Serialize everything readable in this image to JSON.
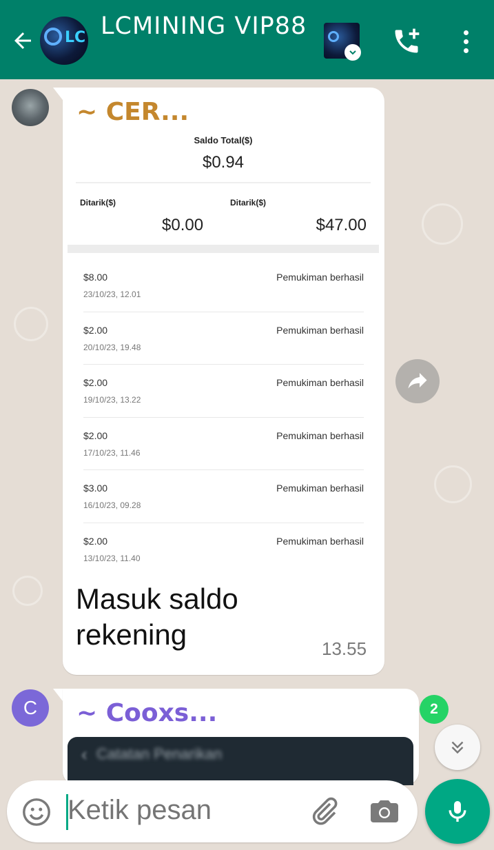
{
  "header": {
    "title": "LCMINING VIP88",
    "avatar_icon": "group-avatar",
    "back_icon": "arrow-left-icon",
    "video_icon": "video-call-icon",
    "call_icon": "add-call-icon",
    "menu_icon": "more-vertical-icon",
    "avatar_logo_text": "LC"
  },
  "messages": [
    {
      "sender": "~ CER...",
      "sender_color": "#c4872d",
      "screenshot": {
        "saldo_label": "Saldo Total($)",
        "saldo_value": "$0.94",
        "ditarik_label_1": "Ditarik($)",
        "ditarik_value_1": "$0.00",
        "ditarik_label_2": "Ditarik($)",
        "ditarik_value_2": "$47.00",
        "transactions": [
          {
            "amount": "$8.00",
            "date": "23/10/23, 12.01",
            "status": "Pemukiman berhasil"
          },
          {
            "amount": "$2.00",
            "date": "20/10/23, 19.48",
            "status": "Pemukiman berhasil"
          },
          {
            "amount": "$2.00",
            "date": "19/10/23, 13.22",
            "status": "Pemukiman berhasil"
          },
          {
            "amount": "$2.00",
            "date": "17/10/23, 11.46",
            "status": "Pemukiman berhasil"
          },
          {
            "amount": "$3.00",
            "date": "16/10/23, 09.28",
            "status": "Pemukiman berhasil"
          },
          {
            "amount": "$2.00",
            "date": "13/10/23, 11.40",
            "status": "Pemukiman berhasil"
          }
        ]
      },
      "caption": "Masuk saldo rekening",
      "time": "13.55"
    },
    {
      "sender": "~ Cooxs...",
      "sender_color": "#7b5fd6",
      "avatar_letter": "C",
      "screenshot_title": "Catatan Penarikan"
    }
  ],
  "unread_count": "2",
  "composer": {
    "placeholder": "Ketik pesan",
    "emoji_icon": "emoji-icon",
    "attach_icon": "paperclip-icon",
    "camera_icon": "camera-icon",
    "mic_icon": "mic-icon"
  },
  "colors": {
    "header_bg": "#008069",
    "accent": "#00a884",
    "badge": "#25d366",
    "wallpaper": "#e5ddd5"
  }
}
